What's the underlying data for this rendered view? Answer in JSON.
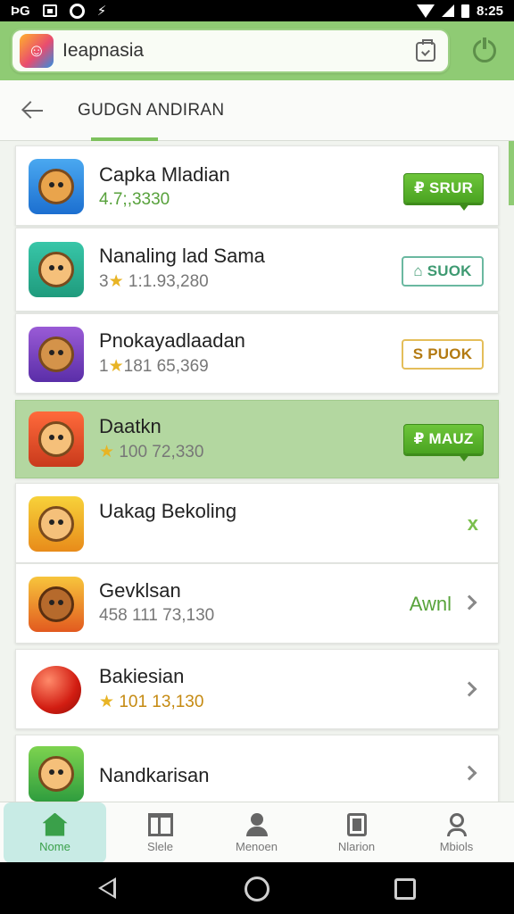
{
  "status_bar": {
    "left_text": "ÞG",
    "time": "8:25"
  },
  "header": {
    "search_text": "Ieapnasia"
  },
  "sub_header": {
    "title": "GUDGN ANDIRAN"
  },
  "apps": [
    {
      "name": "Capka Mladian",
      "meta": "4.7;,3330",
      "action": "₽ SRUR"
    },
    {
      "name": "Nanaling lad Sama",
      "meta_star_prefix": "3",
      "meta": "1:1.93,280",
      "action": "SUOK"
    },
    {
      "name": "Pnokayadlaadan",
      "meta_star_prefix": "1",
      "meta": "181 65,369",
      "action": "S PUOK"
    },
    {
      "name": "Daatkn",
      "meta": "100 72,330",
      "action": "₽ MAUZ"
    },
    {
      "name": "Uakag Bekoling",
      "action": "x"
    },
    {
      "name": "Gevklsan",
      "meta": "458 111 73,130",
      "action": "Awnl"
    },
    {
      "name": "Bakiesian",
      "meta": "101 13,130"
    },
    {
      "name": "Nandkarisan"
    }
  ],
  "bottom_nav": [
    {
      "label": "Nome",
      "icon": "home-icon"
    },
    {
      "label": "Slele",
      "icon": "books-icon"
    },
    {
      "label": "Menoen",
      "icon": "person-icon"
    },
    {
      "label": "Nlarion",
      "icon": "phone-icon"
    },
    {
      "label": "Mbiols",
      "icon": "profile-icon"
    }
  ],
  "colors": {
    "accent_green": "#7dc15d",
    "header_green": "#8fcb74",
    "highlight_row": "#b3d7a0"
  }
}
